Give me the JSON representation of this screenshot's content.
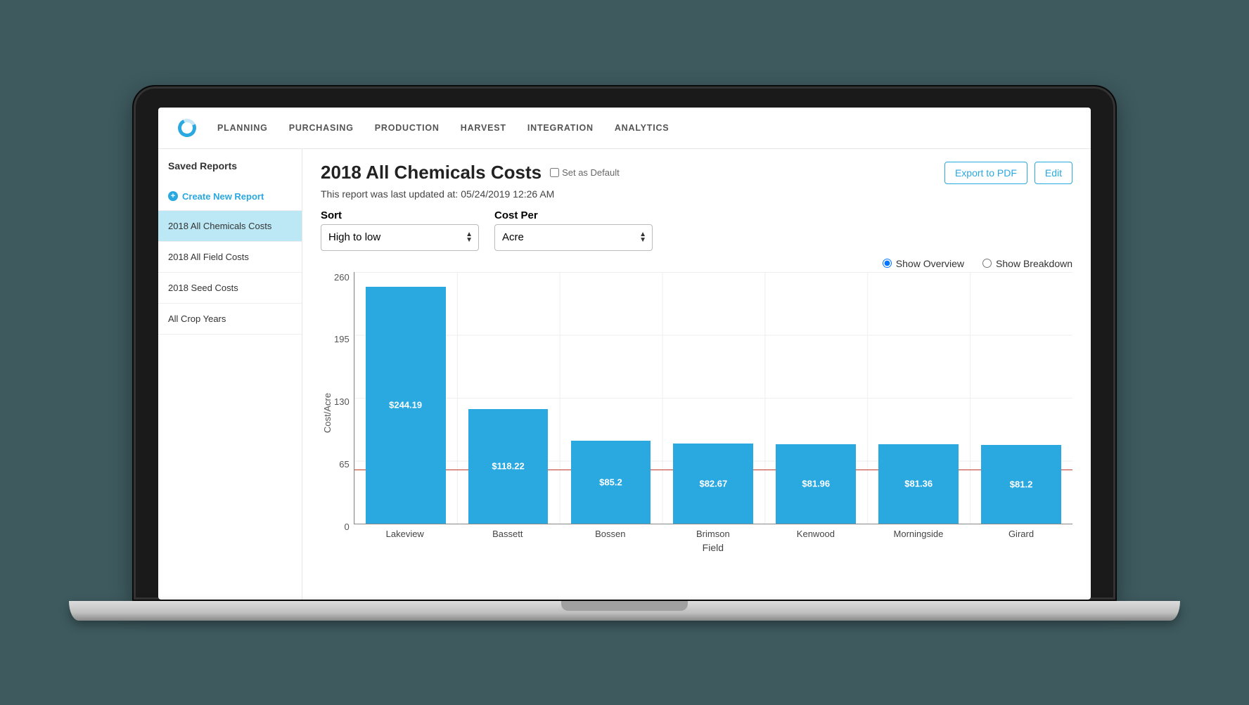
{
  "nav": {
    "items": [
      "PLANNING",
      "PURCHASING",
      "PRODUCTION",
      "HARVEST",
      "INTEGRATION",
      "ANALYTICS"
    ]
  },
  "sidebar": {
    "title": "Saved Reports",
    "create_label": "Create New Report",
    "items": [
      {
        "label": "2018 All Chemicals Costs",
        "active": true
      },
      {
        "label": "2018 All Field Costs",
        "active": false
      },
      {
        "label": "2018 Seed Costs",
        "active": false
      },
      {
        "label": "All Crop Years",
        "active": false
      }
    ]
  },
  "header": {
    "title": "2018 All Chemicals Costs",
    "default_label": "Set as Default",
    "updated_prefix": "This report was last updated at: ",
    "updated_at": "05/24/2019 12:26 AM",
    "export_label": "Export to PDF",
    "edit_label": "Edit"
  },
  "controls": {
    "sort_label": "Sort",
    "sort_value": "High to low",
    "costper_label": "Cost Per",
    "costper_value": "Acre"
  },
  "view": {
    "overview_label": "Show Overview",
    "breakdown_label": "Show Breakdown",
    "selected": "overview"
  },
  "chart_data": {
    "type": "bar",
    "categories": [
      "Lakeview",
      "Bassett",
      "Bossen",
      "Brimson",
      "Kenwood",
      "Morningside",
      "Girard"
    ],
    "values": [
      244.19,
      118.22,
      85.2,
      82.67,
      81.96,
      81.36,
      81.2
    ],
    "value_labels": [
      "$244.19",
      "$118.22",
      "$85.2",
      "$82.67",
      "$81.96",
      "$81.36",
      "$81.2"
    ],
    "ylabel": "Cost/Acre",
    "xlabel": "Field",
    "ylim": [
      0,
      260
    ],
    "yticks": [
      0,
      65,
      130,
      195,
      260
    ],
    "reference_line": 55
  }
}
